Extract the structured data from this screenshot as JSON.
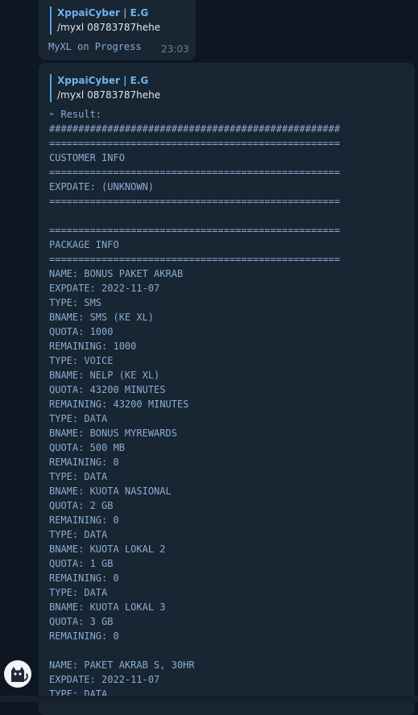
{
  "messages": [
    {
      "reply_author": "XppaiCyber | E.G",
      "reply_text": "/myxl 08783787hehe",
      "text": "MyXL on Progress",
      "time": "23:03"
    },
    {
      "reply_author": "XppaiCyber | E.G",
      "reply_text": "/myxl 08783787hehe",
      "lines": [
        "➣ Result:",
        "##################################################",
        "==================================================",
        "CUSTOMER INFO",
        "==================================================",
        "EXPDATE: (UNKNOWN)",
        "==================================================",
        "",
        "==================================================",
        "PACKAGE INFO",
        "==================================================",
        "NAME: BONUS PAKET AKRAB",
        "EXPDATE: 2022-11-07",
        "TYPE: SMS",
        "BNAME: SMS (KE XL)",
        "QUOTA: 1000",
        "REMAINING: 1000",
        "TYPE: VOICE",
        "BNAME: NELP (KE XL)",
        "QUOTA: 43200 MINUTES",
        "REMAINING: 43200 MINUTES",
        "TYPE: DATA",
        "BNAME: BONUS MYREWARDS",
        "QUOTA: 500 MB",
        "REMAINING: 0",
        "TYPE: DATA",
        "BNAME: KUOTA NASIONAL",
        "QUOTA: 2 GB",
        "REMAINING: 0",
        "TYPE: DATA",
        "BNAME: KUOTA LOKAL 2",
        "QUOTA: 1 GB",
        "REMAINING: 0",
        "TYPE: DATA",
        "BNAME: KUOTA LOKAL 3",
        "QUOTA: 3 GB",
        "REMAINING: 0",
        "",
        "NAME: PAKET AKRAB S, 30HR",
        "EXPDATE: 2022-11-07",
        "TYPE: DATA"
      ]
    }
  ],
  "avatar_icon": "cat-icon",
  "colors": {
    "background": "#0e1621",
    "bubble": "#182533",
    "accent": "#5ea3df",
    "mono_text": "#8aacd1"
  }
}
